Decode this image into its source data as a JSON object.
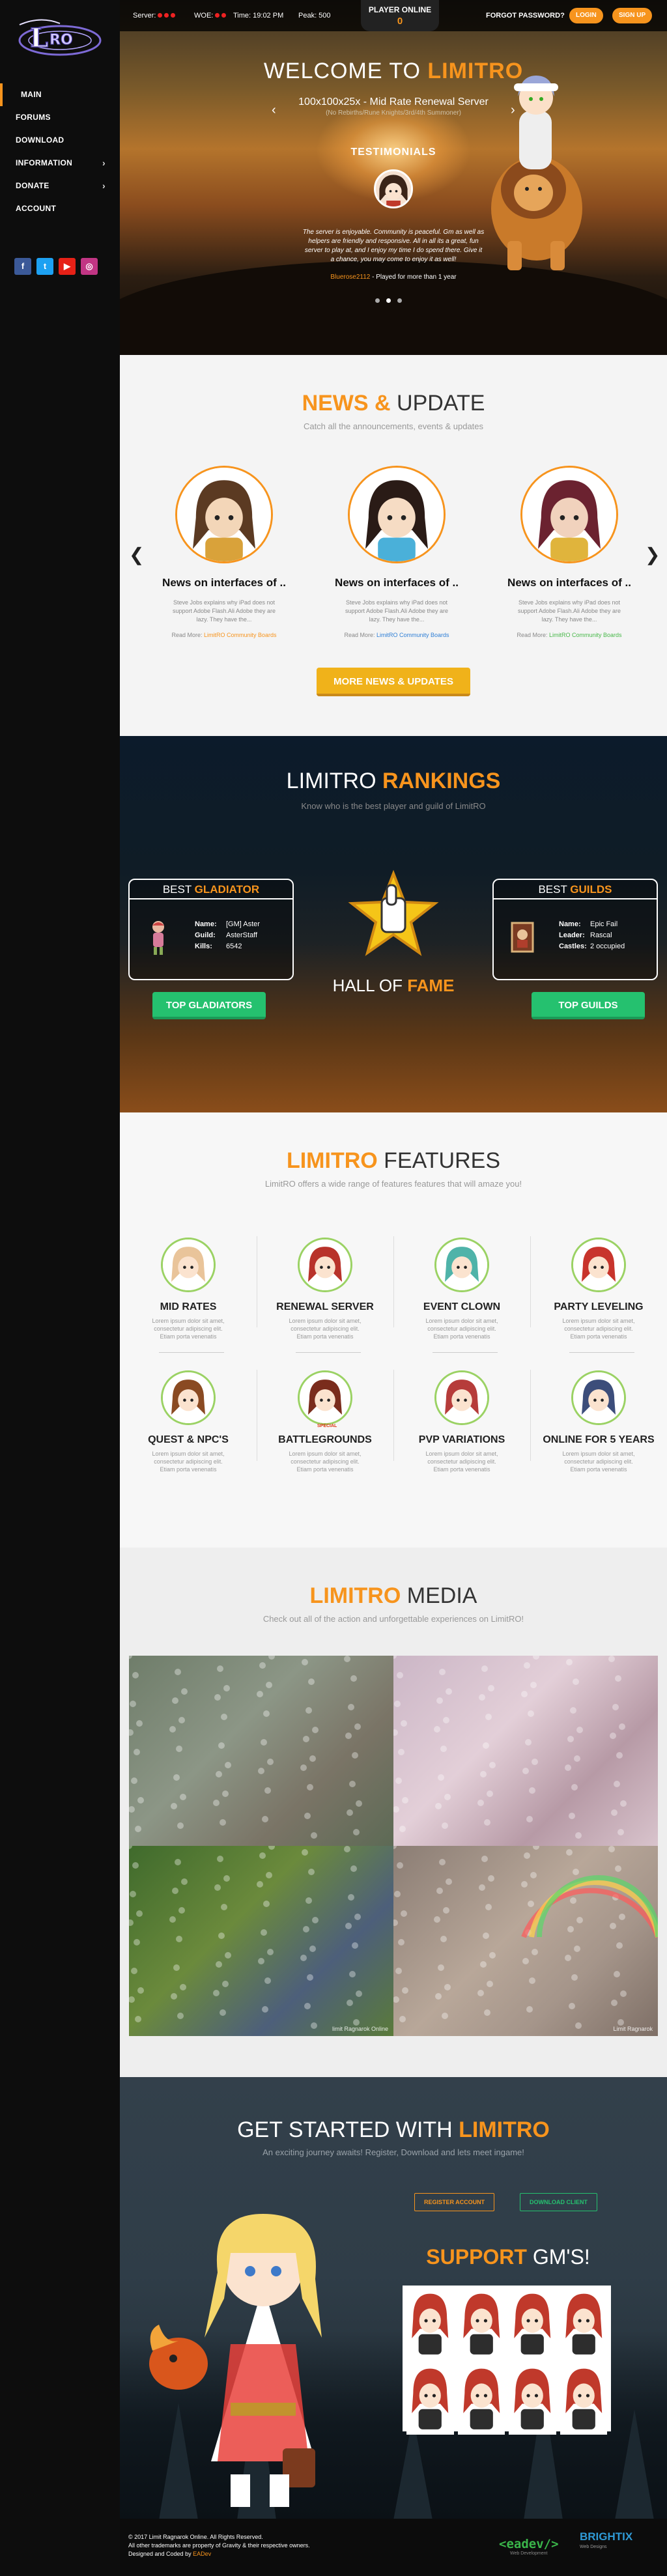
{
  "brand": {
    "colors": {
      "accent": "#f7941d",
      "green": "#25c16f",
      "yellow": "#f0b21a",
      "sidebar": "#0d0d0d"
    }
  },
  "sidebar": {
    "items": [
      {
        "label": "MAIN",
        "active": true
      },
      {
        "label": "FORUMS"
      },
      {
        "label": "DOWNLOAD"
      },
      {
        "label": "INFORMATION",
        "chevron": "›"
      },
      {
        "label": "DONATE",
        "chevron": "›"
      },
      {
        "label": "ACCOUNT"
      }
    ],
    "socials": [
      {
        "icon": "facebook-icon",
        "glyph": "f",
        "color": "#3b5998"
      },
      {
        "icon": "twitter-icon",
        "glyph": "t",
        "color": "#1da1f2"
      },
      {
        "icon": "youtube-icon",
        "glyph": "▶",
        "color": "#e62117"
      },
      {
        "icon": "instagram-icon",
        "glyph": "◎",
        "color": "#c13584"
      }
    ]
  },
  "topbar": {
    "server_label": "Server:",
    "woe_label": "WOE:",
    "time_label": "Time: 19:02 PM",
    "peak_label": "Peak: 500",
    "online_label": "PLAYER ONLINE",
    "online_value": "0",
    "forgot_label": "FORGOT PASSWORD?",
    "login_label": "LOGIN",
    "signup_label": "SIGN UP"
  },
  "hero": {
    "title_prefix": "WELCOME TO ",
    "title_highlight": "LIMITRO",
    "subtitle": "100x100x25x - Mid Rate Renewal Server",
    "subtitle2": "(No Rebirths/Rune Knights/3rd/4th Summoner)",
    "prev_arrow": "‹",
    "next_arrow": "›",
    "testimonials_title": "TESTIMONIALS",
    "testimonial_quote": "The server is enjoyable. Community is peaceful. Gm as well as helpers are friendly and responsive. All in all its a great, fun server to play at, and I enjoy my time I do spend there. Give it a chance, you may come to enjoy it as well!",
    "testimonial_author": "Bluerose2112",
    "testimonial_tail": " - Played for more than 1 year",
    "dots": 3
  },
  "news": {
    "title_highlight": "NEWS &",
    "title_rest": " UPDATE",
    "subtitle": "Catch all the announcements, events & updates",
    "prev_arrow": "❮",
    "next_arrow": "❯",
    "cards": [
      {
        "title": "News on interfaces of ..",
        "body": "Steve Jobs explains why iPad does not support Adobe Flash.Ali Adobe they are lazy. They have the...",
        "read_more": "Read More: ",
        "link": "LimitRO Community Boards",
        "link_color": "#f7941d"
      },
      {
        "title": "News on interfaces of ..",
        "body": "Steve Jobs explains why iPad does not support Adobe Flash.Ali Adobe they are lazy. They have the...",
        "read_more": "Read More: ",
        "link": "LimitRO Community Boards",
        "link_color": "#2f7fd6"
      },
      {
        "title": "News on interfaces of ..",
        "body": "Steve Jobs explains why iPad does not support Adobe Flash.Ali Adobe they are lazy. They have the...",
        "read_more": "Read More: ",
        "link": "LimitRO Community Boards",
        "link_color": "#48b84a"
      }
    ],
    "more_label": "MORE NEWS & UPDATES"
  },
  "rankings": {
    "title_prefix": "LIMITRO ",
    "title_highlight": "RANKINGS",
    "subtitle": "Know who is the best player and guild of LimitRO",
    "gladiator": {
      "label_prefix": "BEST ",
      "label_highlight": "GLADIATOR",
      "name_label": "Name:",
      "name": "[GM] Aster",
      "guild_label": "Guild:",
      "guild": "AsterStaff",
      "kills_label": "Kills:",
      "kills": "6542",
      "button": "TOP GLADIATORS"
    },
    "guilds": {
      "label_prefix": "BEST ",
      "label_highlight": "GUILDS",
      "name_label": "Name:",
      "name": "Epic Fail",
      "leader_label": "Leader:",
      "leader": "Rascal",
      "castles_label": "Castles:",
      "castles": "2 occupied",
      "button": "TOP GUILDS"
    },
    "hof_prefix": "HALL OF ",
    "hof_highlight": "FAME"
  },
  "features": {
    "title_highlight": "LIMITRO",
    "title_rest": " FEATURES",
    "subtitle": "LimitRO offers a wide range of features features that will amaze you!",
    "lorem": "Lorem ipsum dolor sit amet, consectetur adipiscing elit. Etiam porta venenatis",
    "items": [
      {
        "title": "MID RATES"
      },
      {
        "title": "RENEWAL SERVER"
      },
      {
        "title": "EVENT CLOWN"
      },
      {
        "title": "PARTY LEVELING"
      },
      {
        "title": "QUEST & NPC'S"
      },
      {
        "title": "BATTLEGROUNDS",
        "ribbon": "SPECIAL"
      },
      {
        "title": "PVP VARIATIONS"
      },
      {
        "title": "ONLINE FOR 5 YEARS"
      }
    ]
  },
  "media": {
    "title_highlight": "LIMITRO",
    "title_rest": " MEDIA",
    "subtitle": "Check out all of the action and unforgettable experiences on LimitRO!",
    "shots": [
      {
        "watermark": ""
      },
      {
        "watermark": ""
      },
      {
        "watermark": "limit Ragnarok Online"
      },
      {
        "watermark": "Limit Ragnarok"
      }
    ]
  },
  "start": {
    "title_prefix": "GET STARTED WITH ",
    "title_highlight": "LIMITRO",
    "subtitle": "An exciting journey awaits! Register, Download and lets meet ingame!",
    "register_label": "REGISTER ACCOUNT",
    "download_label": "DOWNLOAD CLIENT",
    "support_highlight": "SUPPORT",
    "support_rest": " GM'S!",
    "gm_count": 8
  },
  "footer": {
    "line1": "© 2017 Limit Ragnarok Online. All Rights Reserved.",
    "line2": "All other trademarks are property of Gravity & their respective owners.",
    "line3_prefix": "Designed and Coded by ",
    "line3_dev": "EADev",
    "eadev_logo": "<eadev/>",
    "eadev_tag": "Web Development",
    "brightix_logo": "BRIGHTIX",
    "brightix_tag": "Web Designs"
  }
}
